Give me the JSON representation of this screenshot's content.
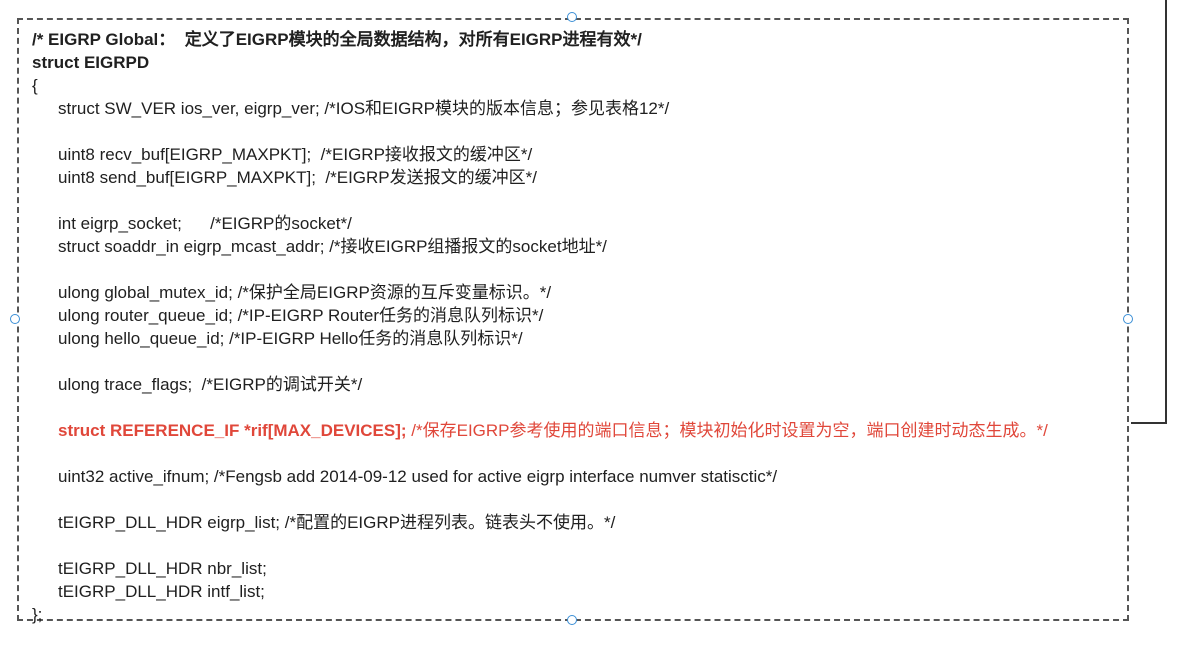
{
  "code_lines": [
    {
      "text": "/* EIGRP Global：  定义了EIGRP模块的全局数据结构，对所有EIGRP进程有效*/",
      "style": "bold"
    },
    {
      "text": "struct EIGRPD",
      "style": "bold"
    },
    {
      "text": "{",
      "style": "plain"
    },
    {
      "text": "struct SW_VER ios_ver, eigrp_ver; /*IOS和EIGRP模块的版本信息；参见表格12*/",
      "style": "indent"
    },
    {
      "text": "",
      "style": "blank"
    },
    {
      "text": "uint8 recv_buf[EIGRP_MAXPKT];  /*EIGRP接收报文的缓冲区*/",
      "style": "indent"
    },
    {
      "text": "uint8 send_buf[EIGRP_MAXPKT];  /*EIGRP发送报文的缓冲区*/",
      "style": "indent"
    },
    {
      "text": "",
      "style": "blank"
    },
    {
      "text": "int eigrp_socket;      /*EIGRP的socket*/",
      "style": "indent"
    },
    {
      "text": "struct soaddr_in eigrp_mcast_addr; /*接收EIGRP组播报文的socket地址*/",
      "style": "indent"
    },
    {
      "text": "",
      "style": "blank"
    },
    {
      "text": "ulong global_mutex_id; /*保护全局EIGRP资源的互斥变量标识。*/",
      "style": "indent"
    },
    {
      "text": "ulong router_queue_id; /*IP-EIGRP Router任务的消息队列标识*/",
      "style": "indent"
    },
    {
      "text": "ulong hello_queue_id; /*IP-EIGRP Hello任务的消息队列标识*/",
      "style": "indent"
    },
    {
      "text": "",
      "style": "blank"
    },
    {
      "text": "ulong trace_flags;  /*EIGRP的调试开关*/",
      "style": "indent"
    },
    {
      "text": "",
      "style": "blank"
    },
    {
      "text": "",
      "style": "red-wrap",
      "bold_part": "struct REFERENCE_IF *rif[MAX_DEVICES];",
      "rest_part": " /*保存EIGRP参考使用的端口信息；模块初始化时设置为空，端口创建时动态生成。*/"
    },
    {
      "text": "uint32 active_ifnum; /*Fengsb add 2014-09-12 used for active eigrp interface numver statisctic*/",
      "style": "indent"
    },
    {
      "text": "",
      "style": "blank"
    },
    {
      "text": "tEIGRP_DLL_HDR eigrp_list; /*配置的EIGRP进程列表。链表头不使用。*/",
      "style": "indent"
    },
    {
      "text": "",
      "style": "blank"
    },
    {
      "text": "tEIGRP_DLL_HDR nbr_list;",
      "style": "indent"
    },
    {
      "text": "tEIGRP_DLL_HDR intf_list;",
      "style": "indent"
    },
    {
      "text": "};",
      "style": "plain"
    }
  ]
}
